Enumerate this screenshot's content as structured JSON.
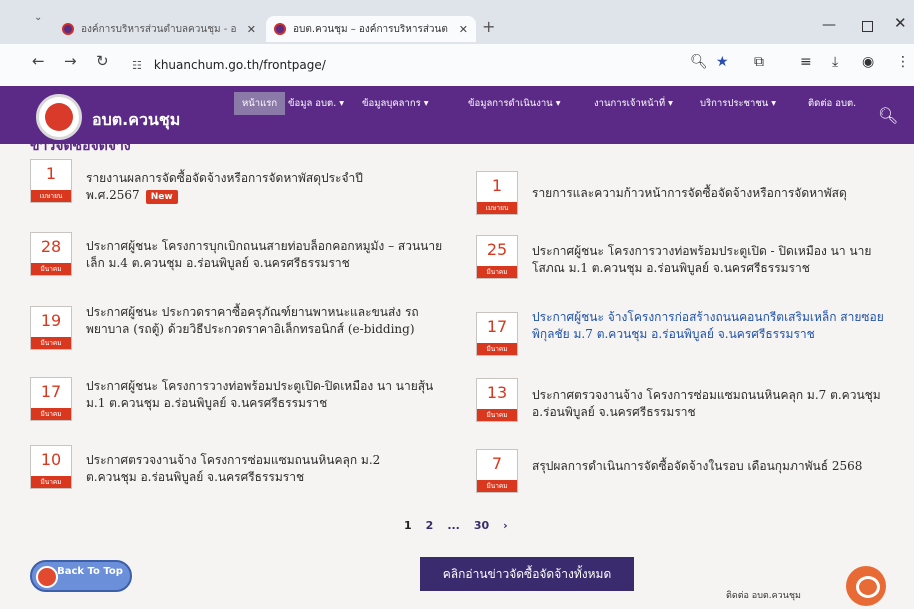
{
  "browser": {
    "tabs": [
      {
        "title": "องค์การบริหารส่วนตำบลควนชุม - อ",
        "active": false
      },
      {
        "title": "อบต.ควนชุม – องค์การบริหารส่วนต",
        "active": true
      }
    ],
    "url": "khuanchum.go.th/frontpage/"
  },
  "site": {
    "name": "อบต.ควนชุม",
    "section_title": "ข่าวจัดซื้อจัดจ้าง",
    "menu": [
      "หน้าแรก",
      "ข้อมูล อบต. ▾",
      "ข้อมูลบุคลากร ▾",
      "ข้อมูลการดำเนินงาน ▾",
      "งานการเจ้าหน้าที่ ▾",
      "บริการประชาชน ▾",
      "ติดต่อ อบต."
    ]
  },
  "news": [
    {
      "day": "1",
      "month": "เมษายน",
      "title": "รายงานผลการจัดซื้อจัดจ้างหรือการจัดหาพัสดุประจำปี พ.ศ.2567",
      "badge": "New"
    },
    {
      "day": "1",
      "month": "เมษายน",
      "title": "รายการและความก้าวหน้าการจัดซื้อจัดจ้างหรือการจัดหาพัสดุ"
    },
    {
      "day": "28",
      "month": "มีนาคม",
      "title": "ประกาศผู้ชนะ โครงการบุกเบิกถนนสายท่อบล็อกคอกหมูมัง – สวนนายเล็ก ม.4 ต.ควนชุม อ.ร่อนพิบูลย์ จ.นครศรีธรรมราช"
    },
    {
      "day": "25",
      "month": "มีนาคม",
      "title": "ประกาศผู้ชนะ โครงการวางท่อพร้อมประตูเปิด - ปิดเหมือง นา นายโสภณ ม.1 ต.ควนชุม อ.ร่อนพิบูลย์ จ.นครศรีธรรมราช"
    },
    {
      "day": "19",
      "month": "มีนาคม",
      "title": "ประกาศผู้ชนะ ประกวดราคาซื้อครุภัณฑ์ยานพาหนะและขนส่ง รถพยาบาล (รถตู้) ด้วยวิธีประกวดราคาอิเล็กทรอนิกส์ (e-bidding)"
    },
    {
      "day": "17",
      "month": "มีนาคม",
      "title": "ประกาศผู้ชนะ จ้างโครงการก่อสร้างถนนคอนกรีตเสริมเหล็ก สายซอยพิกุลชัย ม.7 ต.ควนชุม อ.ร่อนพิบูลย์ จ.นครศรีธรรมราช"
    },
    {
      "day": "17",
      "month": "มีนาคม",
      "title": "ประกาศผู้ชนะ โครงการวางท่อพร้อมประตูเปิด-ปิดเหมือง นา นายสุ้น ม.1 ต.ควนชุม อ.ร่อนพิบูลย์ จ.นครศรีธรรมราช"
    },
    {
      "day": "13",
      "month": "มีนาคม",
      "title": "ประกาศตรวจงานจ้าง โครงการซ่อมแซมถนนหินคลุก ม.7 ต.ควนชุม อ.ร่อนพิบูลย์ จ.นครศรีธรรมราช"
    },
    {
      "day": "10",
      "month": "มีนาคม",
      "title": "ประกาศตรวจงานจ้าง โครงการซ่อมแซมถนนหินคลุก ม.2 ต.ควนชุม อ.ร่อนพิบูลย์ จ.นครศรีธรรมราช"
    },
    {
      "day": "7",
      "month": "มีนาคม",
      "title": "สรุปผลการดำเนินการจัดซื้อจัดจ้างในรอบ เดือนกุมภาพันธ์ 2568"
    }
  ],
  "pagination": {
    "p1": "1",
    "p2": "2",
    "ellipsis": "...",
    "last": "30",
    "next": "›"
  },
  "footer": {
    "back_to_top": "Back To Top",
    "read_all": "คลิกอ่านข่าวจัดซื้อจัดจ้างทั้งหมด",
    "contact": "ติดต่อ อบต.ควนชุม"
  }
}
